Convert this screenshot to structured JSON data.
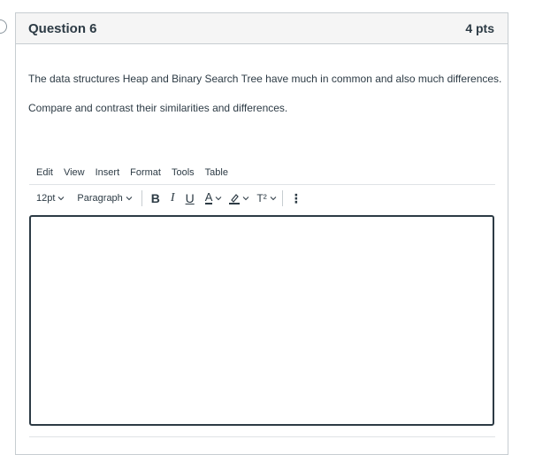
{
  "question": {
    "title": "Question 6",
    "points": "4 pts",
    "prompt_line_1": "The data structures Heap and Binary Search Tree have much in common and also much differences.",
    "prompt_line_2": "Compare and contrast their similarities and differences."
  },
  "editor": {
    "menu": [
      "Edit",
      "View",
      "Insert",
      "Format",
      "Tools",
      "Table"
    ],
    "font_size": "12pt",
    "block_format": "Paragraph",
    "bold_label": "B",
    "italic_label": "I",
    "underline_label": "U",
    "text_color_label": "A",
    "superscript_label": "T²",
    "more_label": "⋮",
    "content": ""
  },
  "colors": {
    "text": "#2d3b45",
    "border": "#c7cdd1",
    "header_bg": "#f5f5f5"
  }
}
